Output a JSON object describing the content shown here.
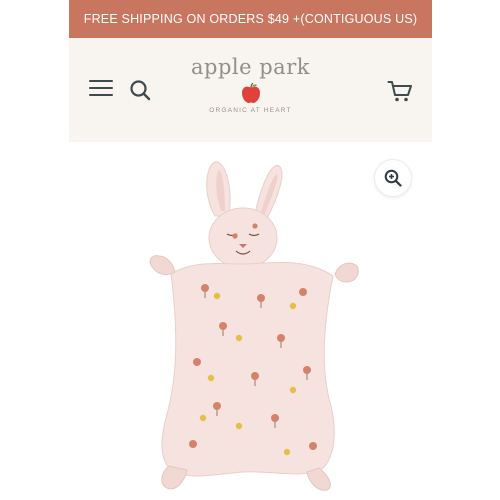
{
  "promo_bar": {
    "text": "FREE SHIPPING ON ORDERS $49 +(CONTIGUOUS US)"
  },
  "header": {
    "logo_text": "apple park",
    "tagline": "ORGANIC AT HEART",
    "icons": [
      "menu-icon",
      "search-icon",
      "apple-logo-icon",
      "cart-icon"
    ]
  },
  "product_image": {
    "icons": [
      "zoom-in-icon"
    ],
    "subject": "bunny-lovey-image"
  },
  "colors": {
    "promo_bg": "#c97660",
    "header_bg": "#f8f4ef",
    "icon_dark": "#3f4a4e",
    "apple_red": "#e0413a",
    "lovey_pink": "#f6e2df"
  }
}
